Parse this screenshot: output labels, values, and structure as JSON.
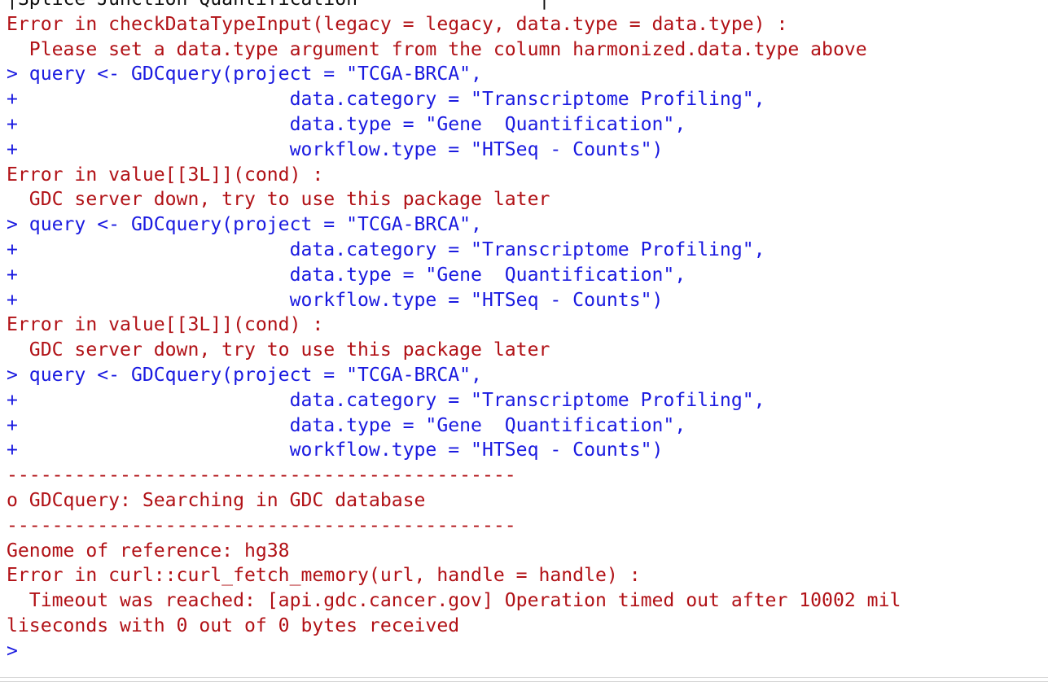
{
  "window": {
    "app": "R Console",
    "background_color": "#ffffff",
    "error_color": "#b11116",
    "input_color": "#1a1ae0",
    "plain_color": "#101010",
    "rule_color": "#d8d8d8",
    "font_size_px": 23,
    "line_height_px": 31
  },
  "console": {
    "prompt_symbol": ">",
    "continuation_symbol": "+",
    "lines": [
      {
        "kind": "plain",
        "text": "|Splice Junction Quantification                |"
      },
      {
        "kind": "err",
        "text": "Error in checkDataTypeInput(legacy = legacy, data.type = data.type) :"
      },
      {
        "kind": "err",
        "text": "  Please set a data.type argument from the column harmonized.data.type above"
      },
      {
        "kind": "input",
        "text": "> query <- GDCquery(project = \"TCGA-BRCA\","
      },
      {
        "kind": "input",
        "text": "+                        data.category = \"Transcriptome Profiling\","
      },
      {
        "kind": "input",
        "text": "+                        data.type = \"Gene  Quantification\","
      },
      {
        "kind": "input",
        "text": "+                        workflow.type = \"HTSeq - Counts\")"
      },
      {
        "kind": "err",
        "text": "Error in value[[3L]](cond) :"
      },
      {
        "kind": "err",
        "text": "  GDC server down, try to use this package later"
      },
      {
        "kind": "input",
        "text": "> query <- GDCquery(project = \"TCGA-BRCA\","
      },
      {
        "kind": "input",
        "text": "+                        data.category = \"Transcriptome Profiling\","
      },
      {
        "kind": "input",
        "text": "+                        data.type = \"Gene  Quantification\","
      },
      {
        "kind": "input",
        "text": "+                        workflow.type = \"HTSeq - Counts\")"
      },
      {
        "kind": "err",
        "text": "Error in value[[3L]](cond) :"
      },
      {
        "kind": "err",
        "text": "  GDC server down, try to use this package later"
      },
      {
        "kind": "input",
        "text": "> query <- GDCquery(project = \"TCGA-BRCA\","
      },
      {
        "kind": "input",
        "text": "+                        data.category = \"Transcriptome Profiling\","
      },
      {
        "kind": "input",
        "text": "+                        data.type = \"Gene  Quantification\","
      },
      {
        "kind": "input",
        "text": "+                        workflow.type = \"HTSeq - Counts\")"
      },
      {
        "kind": "err",
        "text": "---------------------------------------------"
      },
      {
        "kind": "err",
        "text": "o GDCquery: Searching in GDC database"
      },
      {
        "kind": "err",
        "text": "---------------------------------------------"
      },
      {
        "kind": "err",
        "text": "Genome of reference: hg38"
      },
      {
        "kind": "err",
        "text": "Error in curl::curl_fetch_memory(url, handle = handle) :"
      },
      {
        "kind": "err",
        "text": "  Timeout was reached: [api.gdc.cancer.gov] Operation timed out after 10002 mil"
      },
      {
        "kind": "err",
        "text": "liseconds with 0 out of 0 bytes received"
      },
      {
        "kind": "input",
        "text": ">"
      }
    ]
  }
}
